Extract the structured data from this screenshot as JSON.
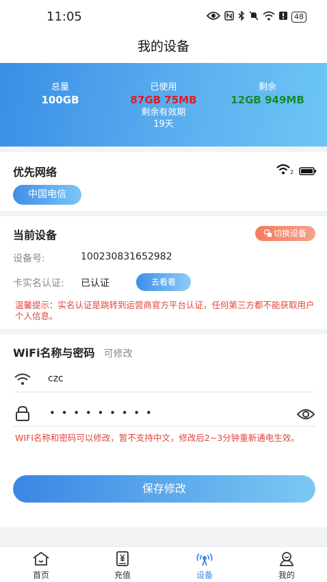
{
  "status_bar": {
    "time": "11:05",
    "battery": "48"
  },
  "header": {
    "title": "我的设备"
  },
  "usage": {
    "total_label": "总量",
    "total_value": "100GB",
    "used_label": "已使用",
    "used_value": "87GB 75MB",
    "remaining_label": "剩余",
    "remaining_value": "12GB 949MB",
    "valid_label": "剩余有效期",
    "valid_value": "19天",
    "colors": {
      "used": "#e01b24",
      "remaining": "#168a2e"
    }
  },
  "network": {
    "title": "优先网络",
    "carrier": "中国电信",
    "signal_sub": "2"
  },
  "device": {
    "title": "当前设备",
    "switch_label": "切换设备",
    "id_label": "设备号:",
    "id_value": "100230831652982",
    "auth_label": "卡实名认证:",
    "auth_value": "已认证",
    "view_button": "去看看",
    "notice": "温馨提示：实名认证是跳转到运营商官方平台认证，任何第三方都不能获取用户个人信息。"
  },
  "wifi": {
    "title": "WiFi名称与密码",
    "editable_hint": "可修改",
    "ssid": "czc",
    "password_masked": "• • • • • • • • •",
    "notice": "WIFI名称和密码可以修改，暂不支持中文，修改后2~3分钟重新通电生效。",
    "save_button": "保存修改"
  },
  "tabs": [
    {
      "label": "首页",
      "icon": "home-icon"
    },
    {
      "label": "充值",
      "icon": "recharge-icon"
    },
    {
      "label": "设备",
      "icon": "device-icon",
      "active": true
    },
    {
      "label": "我的",
      "icon": "profile-icon"
    }
  ],
  "accent": "#3b86e4"
}
